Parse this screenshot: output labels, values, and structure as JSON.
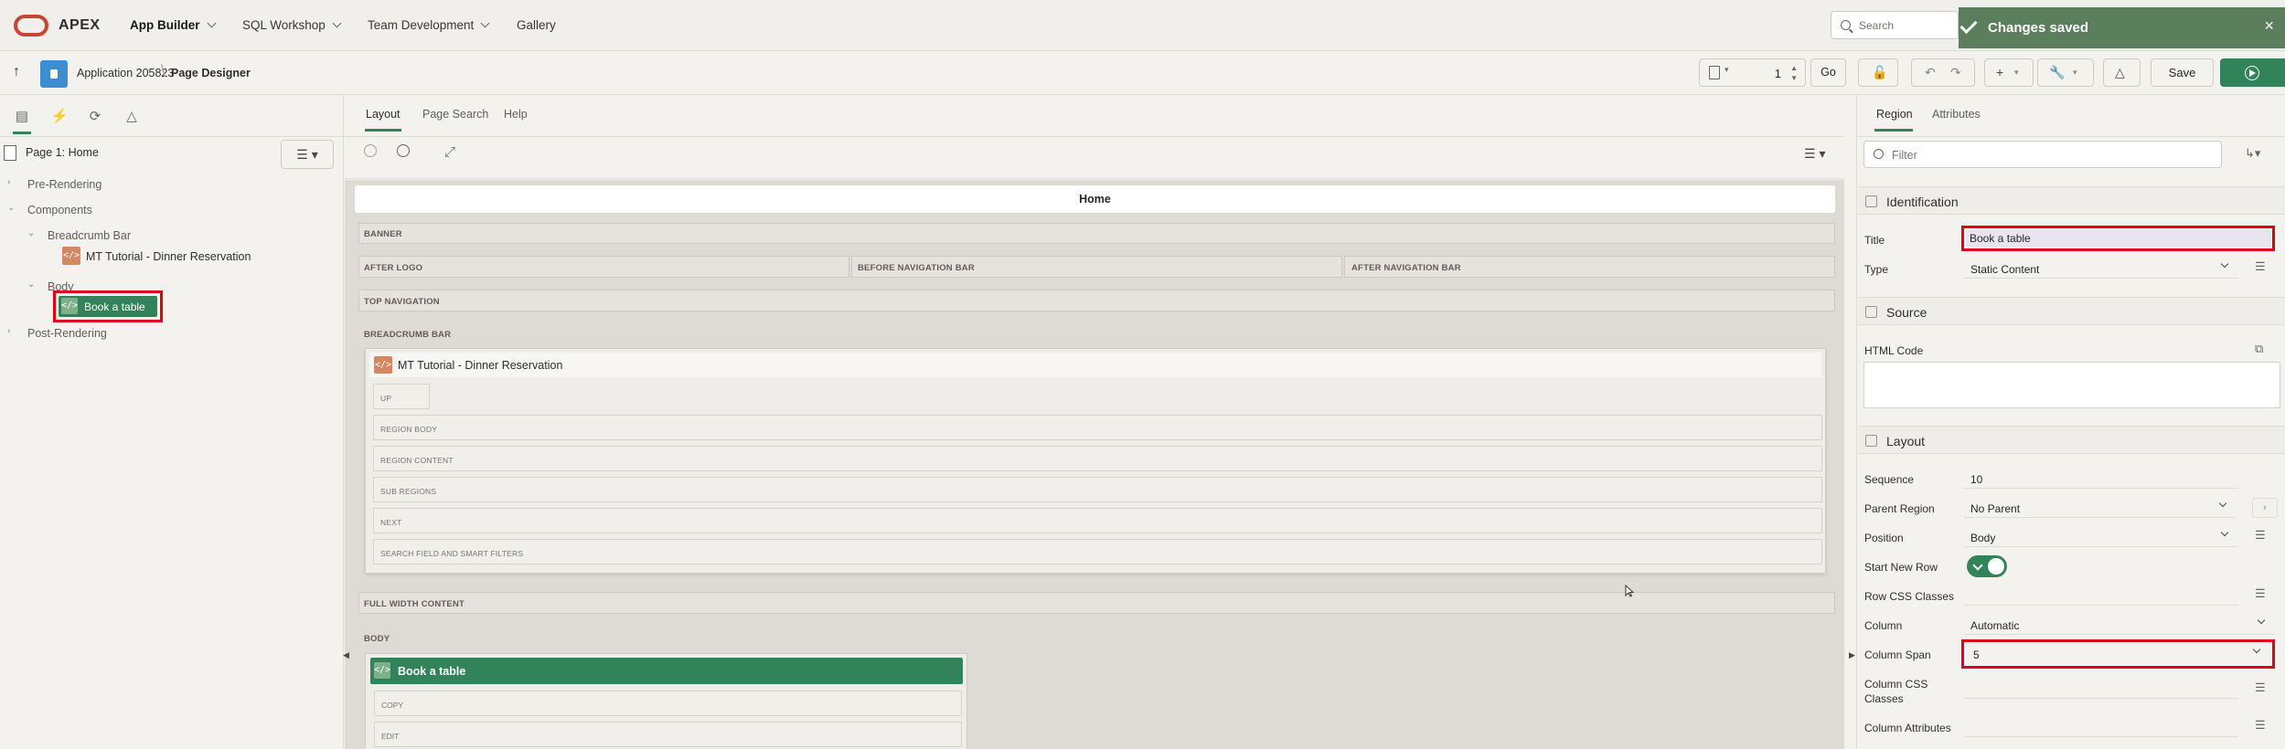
{
  "topnav": {
    "brand": "APEX",
    "items": [
      {
        "label": "App Builder"
      },
      {
        "label": "SQL Workshop"
      },
      {
        "label": "Team Development"
      },
      {
        "label": "Gallery"
      }
    ],
    "search_placeholder": "Search"
  },
  "toast": {
    "message": "Changes saved",
    "close": "×"
  },
  "toolbar": {
    "breadcrumb_app": "Application 205823",
    "breadcrumb_page": "Page Designer",
    "page_number": "1",
    "go_label": "Go",
    "save_label": "Save",
    "run_icon": "play-icon"
  },
  "left_panel": {
    "page_node": "Page 1: Home",
    "tree": [
      {
        "label": "Pre-Rendering"
      },
      {
        "label": "Components"
      },
      {
        "label": "Breadcrumb Bar"
      },
      {
        "label": "MT Tutorial - Dinner Reservation"
      },
      {
        "label": "Body"
      },
      {
        "label": "Book a table"
      },
      {
        "label": "Post-Rendering"
      }
    ]
  },
  "center": {
    "tabs": [
      {
        "label": "Layout"
      },
      {
        "label": "Page Search"
      },
      {
        "label": "Help"
      }
    ],
    "page_title": "Home",
    "slots": {
      "banner": "BANNER",
      "after_logo": "AFTER LOGO",
      "before_nav": "BEFORE NAVIGATION BAR",
      "after_nav": "AFTER NAVIGATION BAR",
      "top_nav": "TOP NAVIGATION",
      "breadcrumb_bar": "BREADCRUMB BAR",
      "full_width": "FULL WIDTH CONTENT",
      "body": "BODY"
    },
    "breadcrumb_region": {
      "title": "MT Tutorial - Dinner Reservation",
      "subslots": [
        "UP",
        "REGION BODY",
        "REGION CONTENT",
        "SUB REGIONS",
        "NEXT",
        "SEARCH FIELD AND SMART FILTERS"
      ]
    },
    "book_region": {
      "title": "Book a table",
      "subslots": [
        "COPY",
        "EDIT"
      ]
    }
  },
  "right_panel": {
    "tabs": [
      {
        "label": "Region"
      },
      {
        "label": "Attributes"
      }
    ],
    "filter_placeholder": "Filter",
    "sections": {
      "identification": "Identification",
      "source": "Source",
      "layout": "Layout"
    },
    "props": {
      "title_label": "Title",
      "title_value": "Book a table",
      "type_label": "Type",
      "type_value": "Static Content",
      "html_label": "HTML Code",
      "sequence_label": "Sequence",
      "sequence_value": "10",
      "parent_label": "Parent Region",
      "parent_value": "No Parent",
      "position_label": "Position",
      "position_value": "Body",
      "startrow_label": "Start New Row",
      "rowcss_label": "Row CSS Classes",
      "column_label": "Column",
      "column_value": "Automatic",
      "colspan_label": "Column Span",
      "colspan_value": "5",
      "colcss_label1": "Column CSS",
      "colcss_label2": "Classes",
      "colattr_label": "Column Attributes"
    },
    "start_new_row_on": true
  },
  "colors": {
    "accent": "#32825a",
    "highlight": "#e0001a",
    "oracle": "#c74634"
  }
}
